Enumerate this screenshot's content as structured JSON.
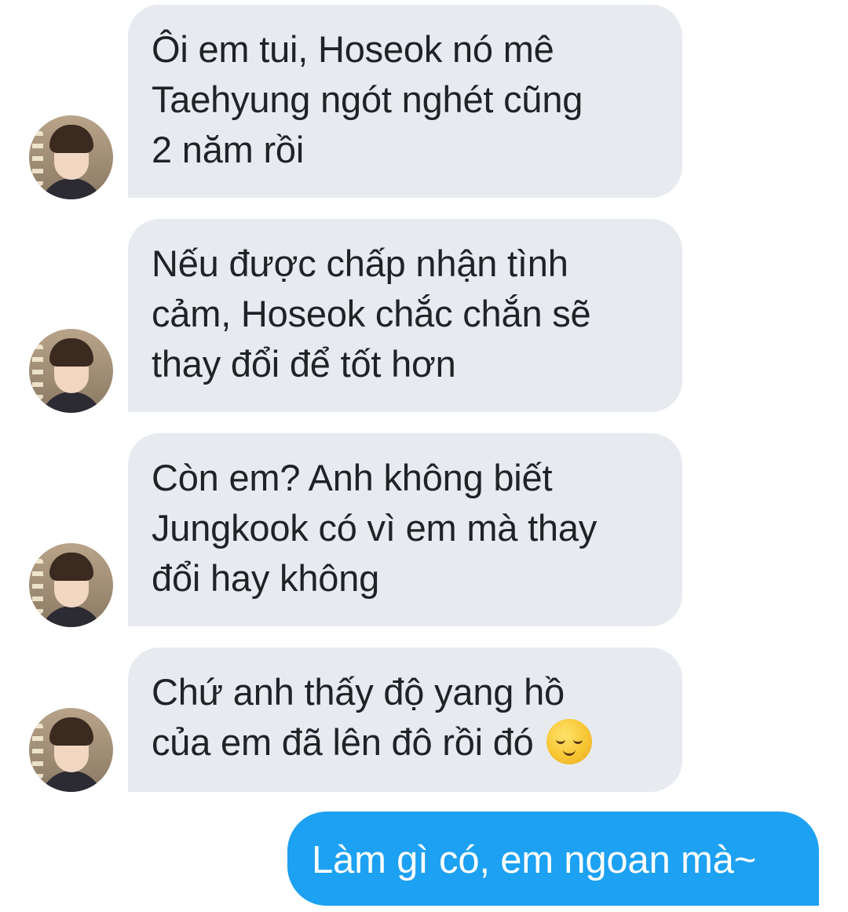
{
  "conversation": {
    "received": [
      {
        "lines": [
          "Ôi em tui, Hoseok nó mê",
          "Taehyung ngót nghét cũng",
          "2 năm rồi"
        ]
      },
      {
        "lines": [
          "Nếu được chấp nhận tình",
          "cảm, Hoseok chắc chắn sẽ",
          "thay đổi để tốt hơn"
        ]
      },
      {
        "lines": [
          "Còn em? Anh không biết",
          "Jungkook có vì em mà thay",
          "đổi hay không"
        ]
      },
      {
        "lines": [
          "Chứ anh thấy độ yang hồ",
          "của em đã lên đô rồi đó"
        ],
        "emoji": "relieved-face-emoji"
      }
    ],
    "sent": [
      {
        "text": "Làm gì có, em ngoan mà~"
      }
    ]
  },
  "colors": {
    "received_bubble": "#e7ebf0",
    "sent_bubble": "#1da1f2",
    "received_text": "#1e2326",
    "sent_text": "#ffffff"
  }
}
